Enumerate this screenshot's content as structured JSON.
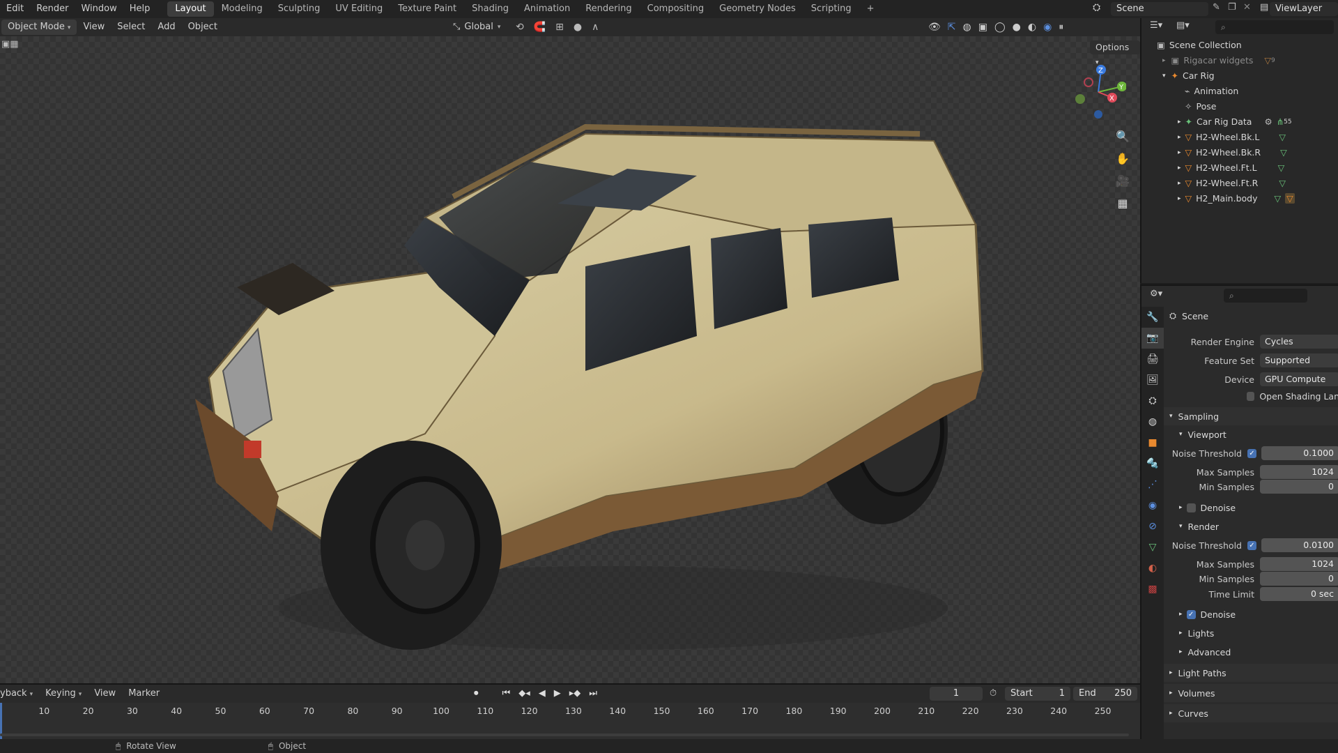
{
  "menu": [
    "Edit",
    "Render",
    "Window",
    "Help"
  ],
  "workspaces": [
    "Layout",
    "Modeling",
    "Sculpting",
    "UV Editing",
    "Texture Paint",
    "Shading",
    "Animation",
    "Rendering",
    "Compositing",
    "Geometry Nodes",
    "Scripting"
  ],
  "workspace_add": "+",
  "scene_name": "Scene",
  "view_layer": "ViewLayer",
  "viewport_header": {
    "mode": "Object Mode",
    "menus": [
      "View",
      "Select",
      "Add",
      "Object"
    ],
    "orientation": "Global",
    "options": "Options"
  },
  "gizmo": {
    "z": "Z",
    "y": "Y",
    "x": "X"
  },
  "outliner": {
    "root": "Scene Collection",
    "items": [
      {
        "label": "Rigacar widgets",
        "badge": "9",
        "depth": 1
      },
      {
        "label": "Car Rig",
        "depth": 1
      },
      {
        "label": "Animation",
        "depth": 2
      },
      {
        "label": "Pose",
        "depth": 2
      },
      {
        "label": "Car Rig Data",
        "badge": "55",
        "depth": 2
      },
      {
        "label": "H2-Wheel.Bk.L",
        "depth": 2
      },
      {
        "label": "H2-Wheel.Bk.R",
        "depth": 2
      },
      {
        "label": "H2-Wheel.Ft.L",
        "depth": 2
      },
      {
        "label": "H2-Wheel.Ft.R",
        "depth": 2
      },
      {
        "label": "H2_Main.body",
        "depth": 2
      }
    ]
  },
  "properties": {
    "context": "Scene",
    "render_engine_label": "Render Engine",
    "render_engine": "Cycles",
    "feature_set_label": "Feature Set",
    "feature_set": "Supported",
    "device_label": "Device",
    "device": "GPU Compute",
    "osl_label": "Open Shading Lan",
    "sampling": "Sampling",
    "viewport": "Viewport",
    "noise_threshold_label": "Noise Threshold",
    "vp_noise": "0.1000",
    "max_samples_label": "Max Samples",
    "vp_max": "1024",
    "min_samples_label": "Min Samples",
    "vp_min": "0",
    "denoise": "Denoise",
    "render": "Render",
    "r_noise": "0.0100",
    "r_max": "1024",
    "r_min": "0",
    "time_limit_label": "Time Limit",
    "time_limit": "0 sec",
    "lights": "Lights",
    "advanced": "Advanced",
    "light_paths": "Light Paths",
    "volumes": "Volumes",
    "curves": "Curves"
  },
  "timeline": {
    "menus": [
      "yback",
      "Keying",
      "View",
      "Marker"
    ],
    "current_frame": "1",
    "start_label": "Start",
    "start": "1",
    "end_label": "End",
    "end": "250",
    "ticks": [
      "10",
      "20",
      "30",
      "40",
      "50",
      "60",
      "70",
      "80",
      "90",
      "100",
      "110",
      "120",
      "130",
      "140",
      "150",
      "160",
      "170",
      "180",
      "190",
      "200",
      "210",
      "220",
      "230",
      "240",
      "250"
    ]
  },
  "status": {
    "left": "Rotate View",
    "mid": "Object"
  },
  "colors": {
    "accent": "#4772b3",
    "object_orange": "#e8892f",
    "mesh_green": "#6ac27a"
  }
}
